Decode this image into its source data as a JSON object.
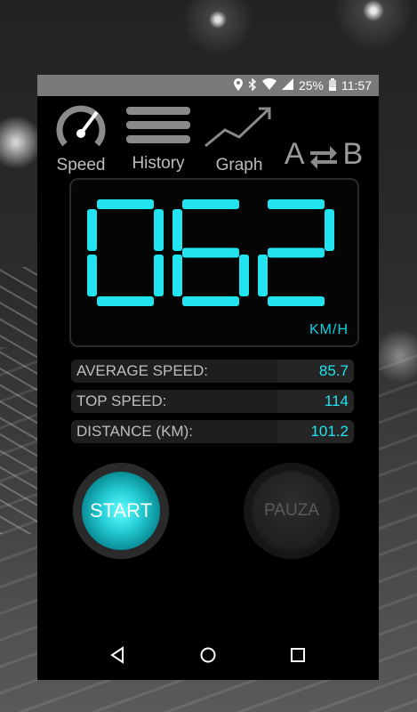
{
  "status_bar": {
    "battery": "25%",
    "time": "11:57",
    "icons": [
      "location-icon",
      "bluetooth-icon",
      "wifi-icon",
      "signal-icon",
      "battery-icon"
    ]
  },
  "tabs": [
    {
      "label": "Speed",
      "icon": "speedometer-icon"
    },
    {
      "label": "History",
      "icon": "list-icon"
    },
    {
      "label": "Graph",
      "icon": "trend-arrow-icon"
    },
    {
      "label": "A⇄B",
      "icon": "swap-icon"
    }
  ],
  "ab_tab": {
    "a": "A",
    "b": "B"
  },
  "speedometer": {
    "reading": "062",
    "unit": "KM/H",
    "color": "#22e4f0"
  },
  "stats": {
    "average_label": "AVERAGE SPEED:",
    "average_value": "85.7",
    "top_label": "TOP SPEED:",
    "top_value": "114",
    "distance_label": "DISTANCE (KM):",
    "distance_value": "101.2"
  },
  "buttons": {
    "start_label": "START",
    "pause_label": "PAUZA"
  },
  "nav": {
    "icons": [
      "back-icon",
      "home-icon",
      "recents-icon"
    ]
  }
}
